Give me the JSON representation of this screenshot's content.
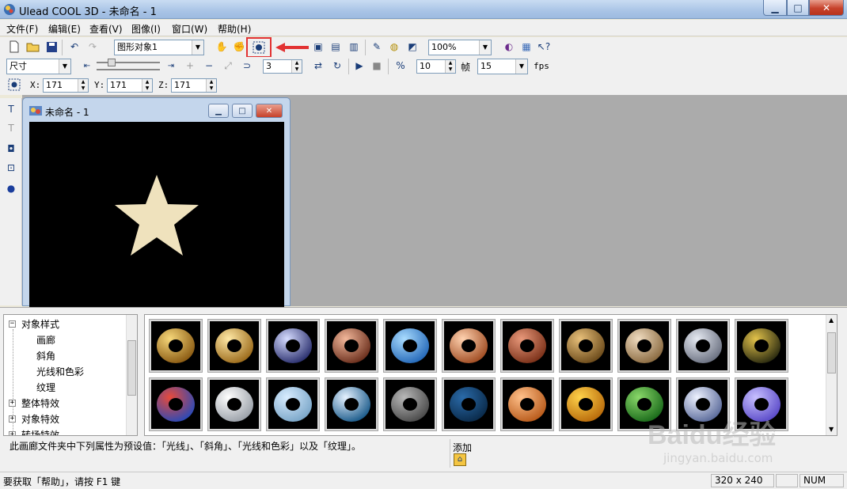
{
  "window": {
    "title": "Ulead COOL 3D - 未命名 - 1",
    "minimize_icon": "minimize-icon",
    "maximize_icon": "maximize-icon",
    "close_icon": "close-icon"
  },
  "menu": [
    "文件(F)",
    "编辑(E)",
    "查看(V)",
    "图像(I)",
    "窗口(W)",
    "帮助(H)"
  ],
  "toolbar1": {
    "object_select": "图形对象1",
    "zoom": "100%",
    "highlighted_tool": "object-position-icon",
    "highlight_color": "#e23232"
  },
  "toolbar2": {
    "property_select": "尺寸",
    "frame_spin": "3",
    "frames_total": "10",
    "frames_label": "帧",
    "fps_value": "15",
    "fps_label": "fps"
  },
  "toolbar3": {
    "x_label": "X:",
    "x_value": "171",
    "y_label": "Y:",
    "y_value": "171",
    "z_label": "Z:",
    "z_value": "171"
  },
  "document": {
    "title": "未命名 - 1",
    "canvas_bg": "#000000",
    "star_color": "#efe2bd"
  },
  "tree": {
    "root": "对象样式",
    "children": [
      "画廊",
      "斜角",
      "光线和色彩",
      "纹理"
    ],
    "siblings": [
      "整体特效",
      "对象特效",
      "转场特效"
    ]
  },
  "gallery": {
    "row1": [
      "gold-ring",
      "gold-ring-2",
      "silver-ring",
      "copper-ring",
      "blue-marble-ring",
      "copper-shine-ring",
      "red-clay-ring",
      "bronze-ring",
      "mesh-ring",
      "steel-ring",
      "gold-spot-ring"
    ],
    "row2": [
      "stained-glass-ring",
      "white-ring",
      "cloud-ring",
      "water-ring",
      "bolted-ring",
      "dark-blue-ring",
      "orange-ring",
      "amber-ring",
      "green-ring",
      "chrome-ring",
      "violet-ring"
    ]
  },
  "description": "此画廊文件夹中下列属性为预设值：「光线」、「斜角」、「光线和色彩」以及「纹理」。",
  "add_label": "添加",
  "status": {
    "help": "要获取「帮助」，请按 F1 键",
    "size": "320 x 240",
    "num": "NUM"
  },
  "watermark": {
    "brand": "Baidu经验",
    "url": "jingyan.baidu.com"
  }
}
